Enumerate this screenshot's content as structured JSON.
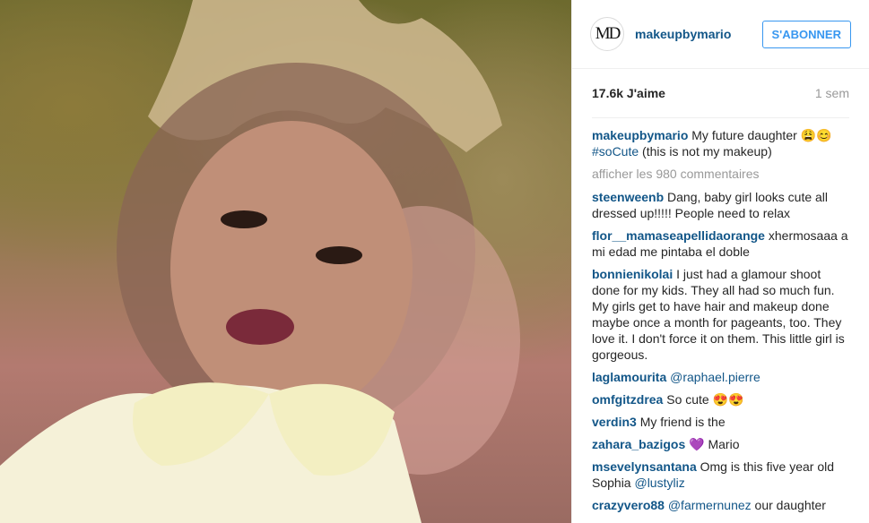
{
  "header": {
    "avatar_initials": "MD",
    "username": "makeupbymario",
    "follow_label": "S'ABONNER"
  },
  "meta": {
    "likes": "17.6k J'aime",
    "time": "1 sem"
  },
  "caption": {
    "user": "makeupbymario",
    "text": " My future daughter 😩😊",
    "hashtag": "#soCute",
    "text2": " (this is not my makeup)"
  },
  "load_more": "afficher les 980 commentaires",
  "comments": [
    {
      "user": "steenweenb",
      "text": " Dang, baby girl looks cute all dressed up!!!!! People need to relax"
    },
    {
      "user": "flor__mamaseapellidaorange",
      "text": " xhermosaaa a mi edad me pintaba el doble"
    },
    {
      "user": "bonnienikolai",
      "text": " I just had a glamour shoot done for my kids. They all had so much fun. My girls get to have hair and makeup done maybe once a month for pageants, too. They love it. I don't force it on them. This little girl is gorgeous."
    },
    {
      "user": "laglamourita",
      "mention": " @raphael.pierre"
    },
    {
      "user": "omfgitzdrea",
      "text": " So cute 😍😍"
    },
    {
      "user": "verdin3",
      "text": " My friend is the"
    },
    {
      "user": "zahara_bazigos",
      "text": " 💜 Mario"
    },
    {
      "user": "msevelynsantana",
      "text": " Omg is this five year old Sophia ",
      "mention": "@lustyliz"
    },
    {
      "user": "crazyvero88",
      "mention": " @farmernunez",
      "text": " our daughter"
    }
  ]
}
